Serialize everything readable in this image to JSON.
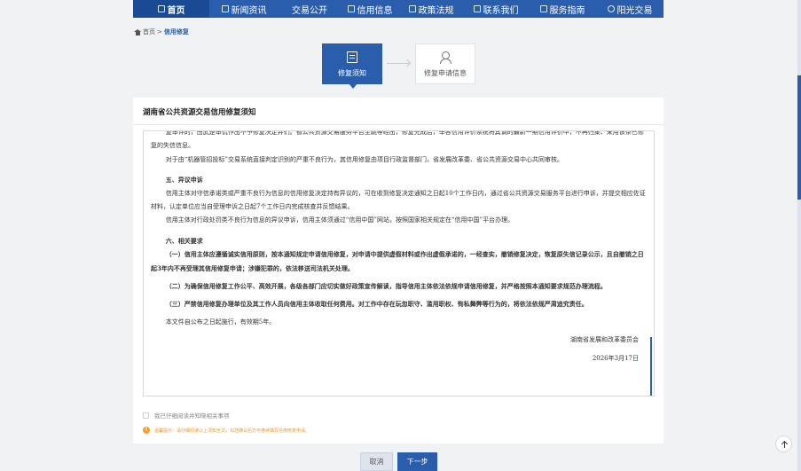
{
  "nav": {
    "items": [
      {
        "label": "首页",
        "icon": "home-icon"
      },
      {
        "label": "新闻资讯",
        "icon": "news-icon"
      },
      {
        "label": "交易公开",
        "icon": ""
      },
      {
        "label": "信用信息",
        "icon": "credit-icon"
      },
      {
        "label": "政策法规",
        "icon": "policy-icon"
      },
      {
        "label": "联系我们",
        "icon": "contact-icon"
      },
      {
        "label": "服务指南",
        "icon": "guide-icon"
      },
      {
        "label": "阳光交易",
        "icon": "sun-icon"
      }
    ],
    "active_index": 0,
    "bg_color": "#2a5dab"
  },
  "breadcrumb": {
    "home": "首页",
    "separator": ">",
    "current": "信用修复"
  },
  "steps": [
    {
      "label": "修复须知",
      "icon": "document-icon",
      "active": true
    },
    {
      "label": "修复申请信息",
      "icon": "user-icon",
      "active": false
    }
  ],
  "panel": {
    "title": "湖南省公共资源交易信用修复须知",
    "notice": {
      "p0": "复审评的，由武是审侃作出不予修复决定并们。省公共资源交易服务平台主跳等经出，修复完成后，举各信用评价系统将其调的最新一期信用评价中，不再归集、采用该条已修复的失信信息。",
      "p1": "对于由“机器管招投标”交易系统直接判定识别的严重不良行为，其信用修复由项目行政监督部门，省发展改革委、省公共资源交易中心共同审核。",
      "h5": "五、异议申诉",
      "p2": "信用主体对守信承诺类或严重不良行为信息的信用修复决定持有异议的，可在收到修复决定通知之日起10个工作日内，通过省公共资源交易服务平台进行申诉，并提交相应佐证材料，认定单位应当自受理申诉之日起7个工作日内完成核查并反馈结果。",
      "p3": "信用主体对行政处罚类不良行为信息的异议申诉，信用主体须通过“信用中国”网站，按照国家相关规定在“信用中国”平台办理。",
      "h6": "六、相关要求",
      "p4": "（一）信用主体应遵循诚实信用原则，按本通知规定申请信用修复，对申请中提供虚假材料或作出虚假承诺的，一经查实，撤销修复决定，恢复原失信记录公示，且自撤销之日起3年内不再受理其信用修复申请；涉嫌犯罪的，依法移送司法机关处理。",
      "p5": "（二）为确保信用修复工作公平、高效开展，各级各部门应切实做好政策宣传解读，指导信用主体依法依规申请信用修复，并严格按照本通知要求规范办理流程。",
      "p6": "（三）严禁信用修复办理单位及其工作人员向信用主体收取任何费用。对工作中存在玩忽职守、滥用职权、徇私舞弊等行为的，将依法依规严肃追究责任。",
      "p7": "本文件自公布之日起施行，有效期5年。",
      "issuer": "湖南省发展和改革委员会",
      "date": "2026年3月17日"
    },
    "agree_label": "我已仔细阅读并知晓相关事项",
    "tip": "温馨提示：请仔细阅读以上须知全文，勾选确认后方可继续填写信用修复申请。"
  },
  "buttons": {
    "cancel": "取消",
    "next": "下一步"
  }
}
